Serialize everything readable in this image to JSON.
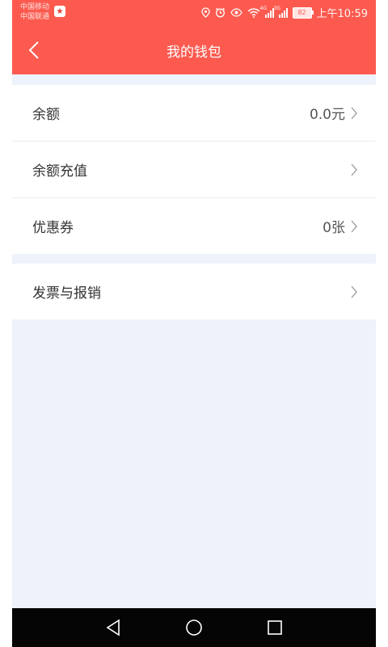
{
  "status_bar": {
    "carrier_1": "中国移动",
    "carrier_2": "中国联通",
    "net_type_1": "4G",
    "net_type_2": "3G",
    "battery": "82",
    "time": "上午10:59"
  },
  "header": {
    "title": "我的钱包",
    "background_color": "#fc5a4f"
  },
  "wallet": {
    "balance": {
      "label": "余额",
      "value": "0.0元"
    },
    "recharge": {
      "label": "余额充值"
    },
    "coupons": {
      "label": "优惠券",
      "value": "0张"
    },
    "invoice": {
      "label": "发票与报销"
    }
  },
  "icons": {
    "back": "chevron-left-icon",
    "arrow": "chevron-right-icon",
    "nav_back": "triangle-back-icon",
    "nav_home": "circle-home-icon",
    "nav_recent": "square-recent-icon"
  }
}
